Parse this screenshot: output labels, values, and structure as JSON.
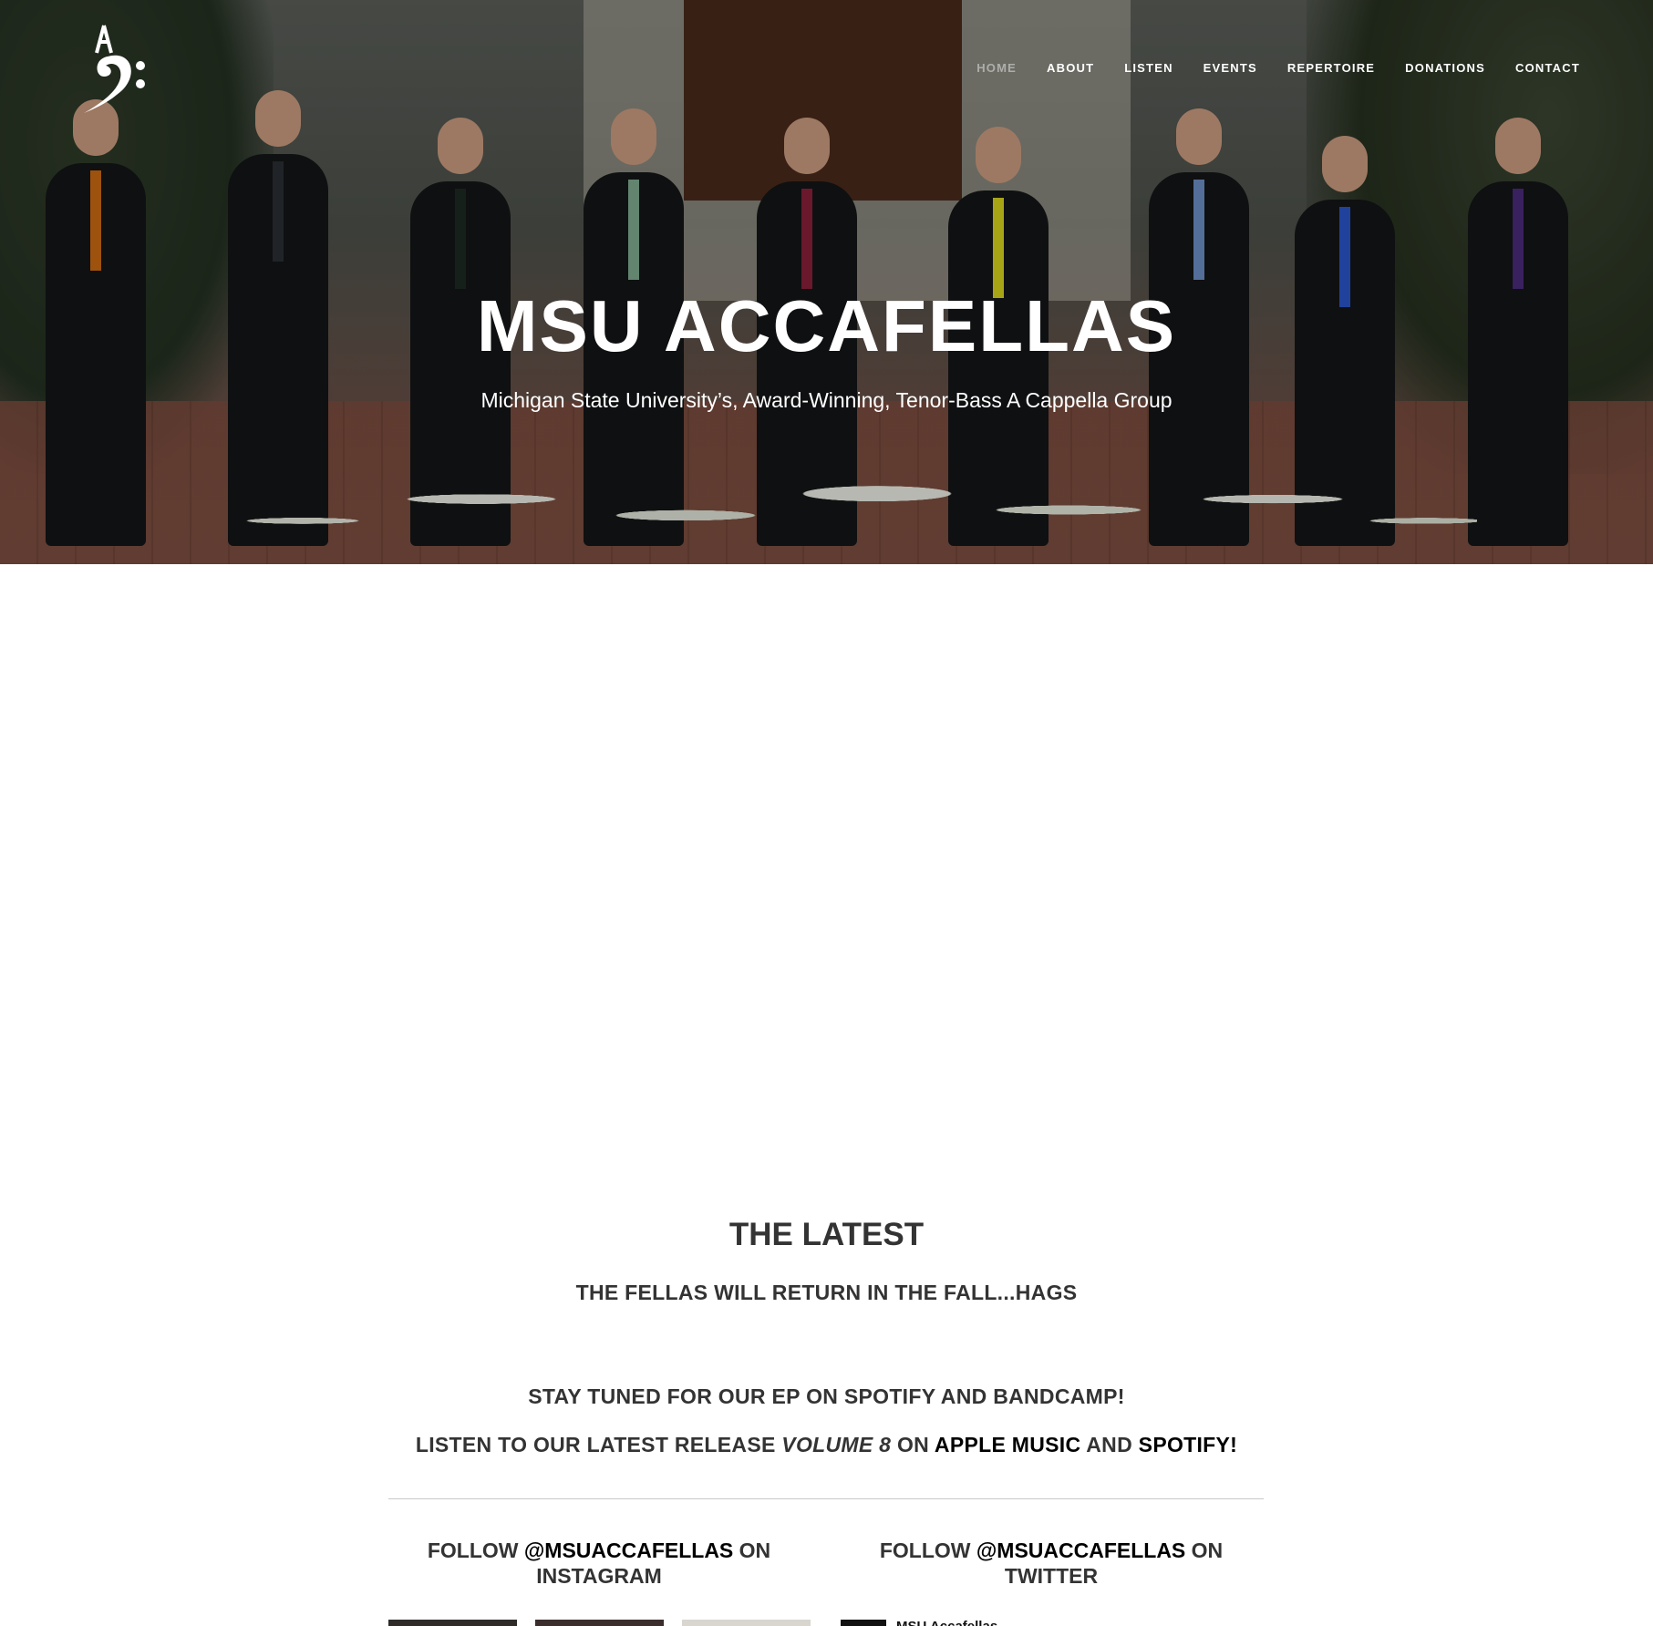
{
  "nav": {
    "items": [
      "HOME",
      "ABOUT",
      "LISTEN",
      "EVENTS",
      "REPERTOIRE",
      "DONATIONS",
      "CONTACT"
    ],
    "active_index": 0
  },
  "hero": {
    "title": "MSU ACCAFELLAS",
    "subtitle": "Michigan State University’s, Award-Winning, Tenor-Bass A Cappella Group"
  },
  "latest": {
    "heading": "THE LATEST",
    "line1": "THE FELLAS WILL RETURN IN THE FALL...HAGS",
    "line2": "STAY TUNED FOR OUR EP ON SPOTIFY AND BANDCAMP!",
    "line3": {
      "prefix": "LISTEN TO OUR LATEST RELEASE ",
      "album": "VOLUME 8",
      "mid": " ON ",
      "link1": "APPLE MUSIC",
      "and": " AND ",
      "link2": "SPOTIFY!"
    }
  },
  "social": {
    "instagram": {
      "prefix": "FOLLOW ",
      "handle": "@MSUACCAFELLAS",
      "suffix": " ON INSTAGRAM"
    },
    "twitter": {
      "prefix": "FOLLOW ",
      "handle": "@MSUACCAFELLAS",
      "suffix": " ON TWITTER",
      "account_name": "MSU Accafellas"
    }
  },
  "colors": {
    "ties": [
      "#c96a12",
      "#2a2d33",
      "#1d2a22",
      "#7fa98f",
      "#8a1f3a",
      "#d7d21c",
      "#6b8fc4",
      "#2a55c9",
      "#4a2a7a"
    ]
  }
}
